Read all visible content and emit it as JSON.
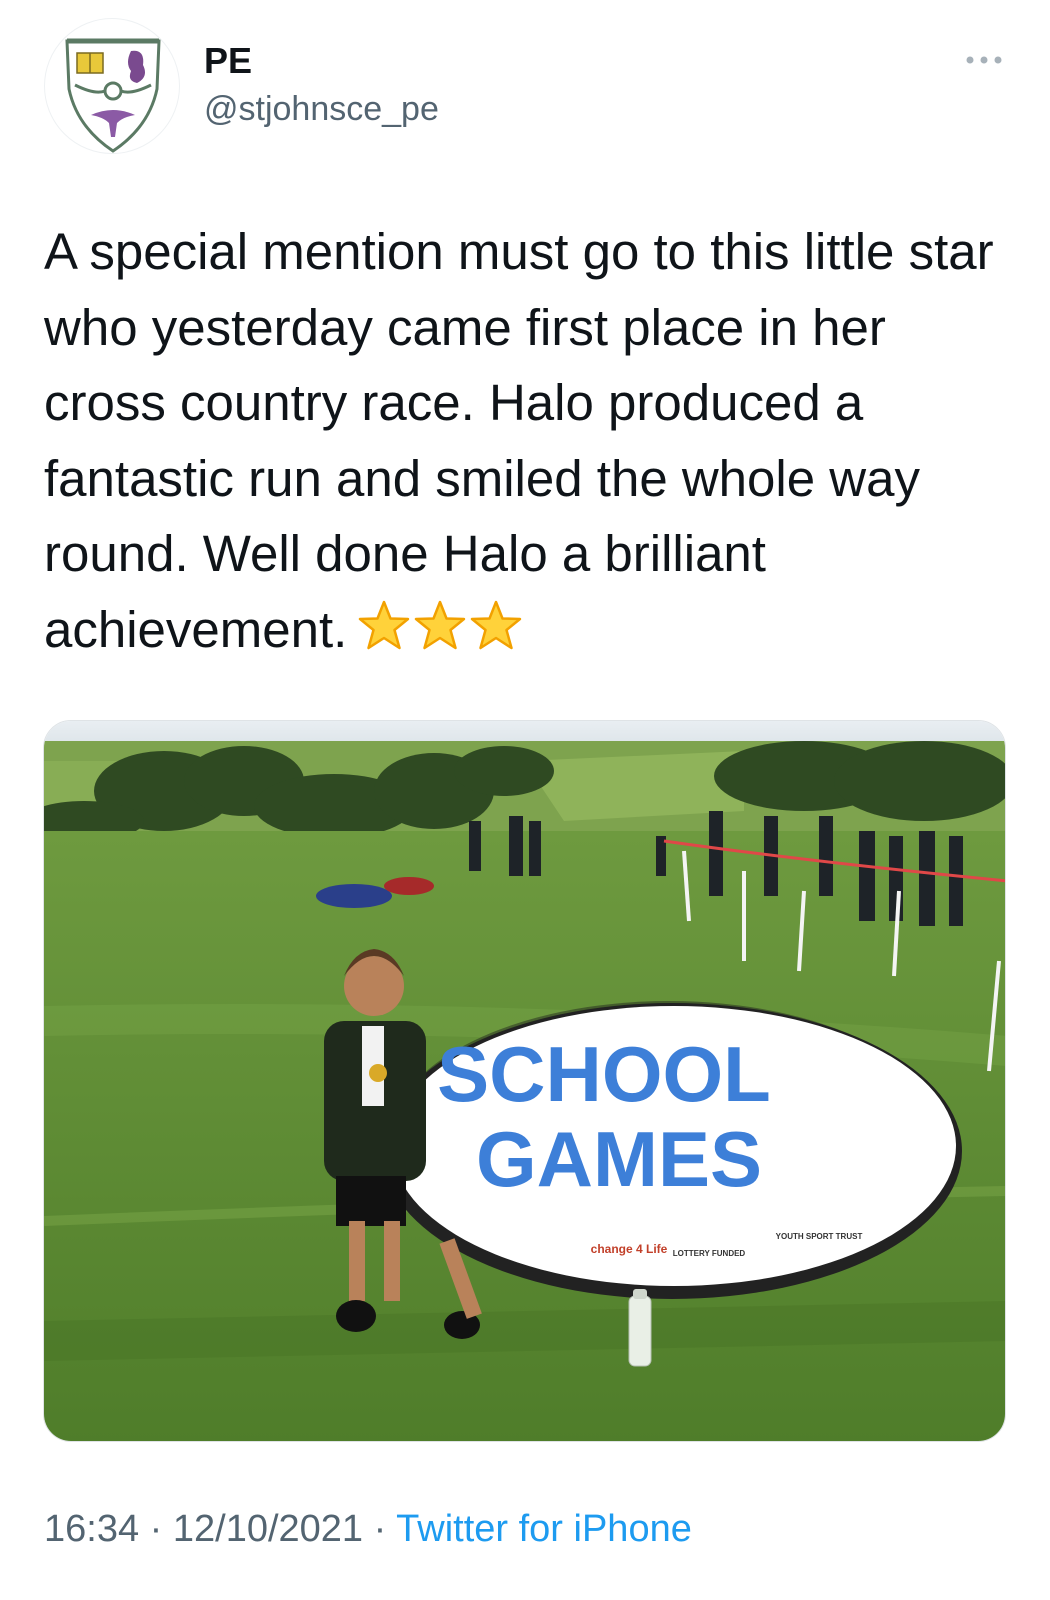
{
  "author": {
    "display_name": "PE",
    "handle": "@stjohnsce_pe"
  },
  "tweet": {
    "text": "A special mention must go to this little star who yesterday came first place in her cross country race. Halo produced a fantastic run and smiled the whole way round. Well done Halo a brilliant achievement.",
    "emoji_count": 3
  },
  "media": {
    "banner_title_line1": "SCHOOL",
    "banner_title_line2": "GAMES",
    "banner_sponsors": [
      "change 4 Life",
      "LOTTERY FUNDED",
      "YOUTH SPORT TRUST"
    ]
  },
  "meta": {
    "time": "16:34",
    "separator": " · ",
    "date": "12/10/2021",
    "source": "Twitter for iPhone"
  },
  "colors": {
    "text": "#0f1419",
    "secondary": "#536471",
    "link": "#1d9bf0",
    "banner_blue": "#3d7fd8",
    "grass": "#5f8f34"
  },
  "icons": {
    "more": "more-horizontal-icon",
    "emoji": "glowing-star-icon",
    "avatar": "school-crest-icon"
  }
}
